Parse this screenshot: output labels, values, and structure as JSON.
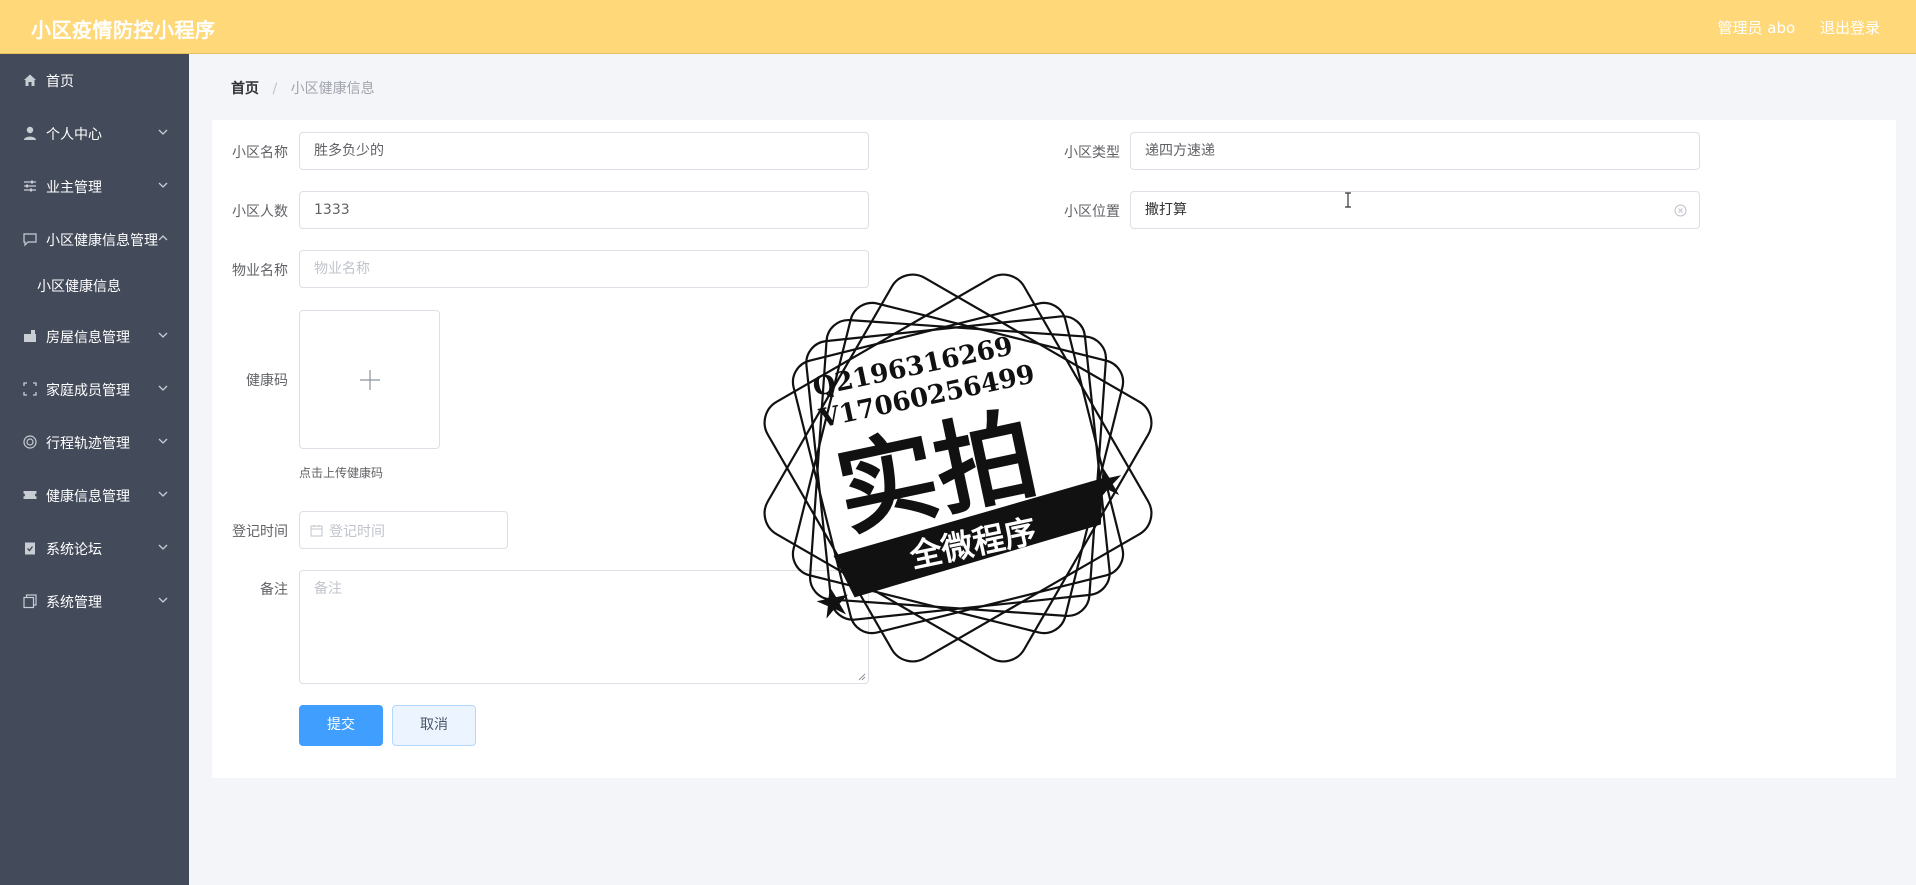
{
  "header": {
    "title": "小区疫情防控小程序",
    "user_label": "管理员 abo",
    "logout_label": "退出登录"
  },
  "sidebar": {
    "items": [
      {
        "label": "首页",
        "icon": "home-icon"
      },
      {
        "label": "个人中心",
        "icon": "user-icon"
      },
      {
        "label": "业主管理",
        "icon": "sliders-icon"
      },
      {
        "label": "小区健康信息管理",
        "icon": "chat-icon",
        "expanded": true,
        "children": [
          {
            "label": "小区健康信息"
          }
        ]
      },
      {
        "label": "房屋信息管理",
        "icon": "building-icon"
      },
      {
        "label": "家庭成员管理",
        "icon": "frame-icon"
      },
      {
        "label": "行程轨迹管理",
        "icon": "target-icon"
      },
      {
        "label": "健康信息管理",
        "icon": "ticket-icon"
      },
      {
        "label": "系统论坛",
        "icon": "clipboard-icon"
      },
      {
        "label": "系统管理",
        "icon": "copy-icon"
      }
    ]
  },
  "breadcrumb": {
    "home": "首页",
    "separator": "/",
    "current": "小区健康信息"
  },
  "form": {
    "name_label": "小区名称",
    "name_value": "胜多负少的",
    "type_label": "小区类型",
    "type_value": "递四方速递",
    "people_label": "小区人数",
    "people_value": "1333",
    "location_label": "小区位置",
    "location_value": "撒打算",
    "property_label": "物业名称",
    "property_placeholder": "物业名称",
    "healthcode_label": "健康码",
    "upload_hint": "点击上传健康码",
    "time_label": "登记时间",
    "time_placeholder": "登记时间",
    "remark_label": "备注",
    "remark_placeholder": "备注",
    "submit_label": "提交",
    "cancel_label": "取消"
  },
  "watermark": {
    "line1": "Q2196316269",
    "line2": "V17060256499",
    "main": "实拍",
    "banner": "全微程序"
  },
  "colors": {
    "header_bg": "#ffd87a",
    "sidebar_bg": "#434a5a",
    "primary": "#409eff",
    "page_bg": "#f4f5f8"
  }
}
